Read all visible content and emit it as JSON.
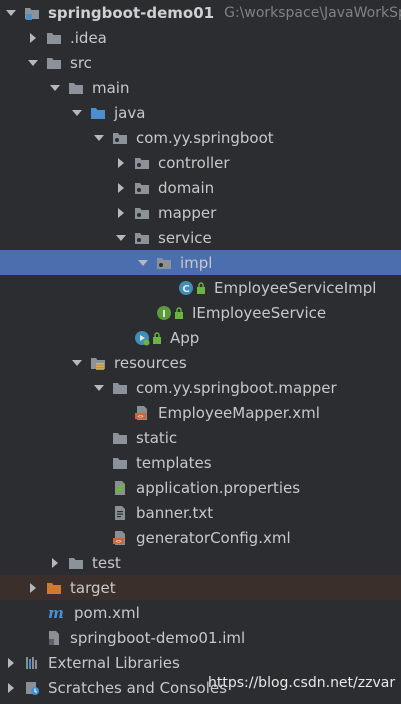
{
  "project_tree": {
    "items": [
      {
        "label": "springboot-demo01",
        "path": "G:\\workspace\\JavaWorkSp",
        "depth": 0,
        "arrow": "down",
        "icons": [
          "module-folder-icon"
        ],
        "bold": true
      },
      {
        "label": ".idea",
        "depth": 1,
        "arrow": "right",
        "icons": [
          "folder-icon"
        ]
      },
      {
        "label": "src",
        "depth": 1,
        "arrow": "down",
        "icons": [
          "folder-icon"
        ]
      },
      {
        "label": "main",
        "depth": 2,
        "arrow": "down",
        "icons": [
          "folder-icon"
        ]
      },
      {
        "label": "java",
        "depth": 3,
        "arrow": "down",
        "icons": [
          "source-folder-icon"
        ]
      },
      {
        "label": "com.yy.springboot",
        "depth": 4,
        "arrow": "down",
        "icons": [
          "package-icon"
        ]
      },
      {
        "label": "controller",
        "depth": 5,
        "arrow": "right",
        "icons": [
          "package-icon"
        ]
      },
      {
        "label": "domain",
        "depth": 5,
        "arrow": "right",
        "icons": [
          "package-icon"
        ]
      },
      {
        "label": "mapper",
        "depth": 5,
        "arrow": "right",
        "icons": [
          "package-icon"
        ]
      },
      {
        "label": "service",
        "depth": 5,
        "arrow": "down",
        "icons": [
          "package-icon"
        ]
      },
      {
        "label": "impl",
        "depth": 6,
        "arrow": "down",
        "icons": [
          "package-icon"
        ],
        "selected": true
      },
      {
        "label": "EmployeeServiceImpl",
        "depth": 7,
        "arrow": "none",
        "icons": [
          "class-icon",
          "lock-icon"
        ]
      },
      {
        "label": "IEmployeeService",
        "depth": 6,
        "arrow": "none",
        "icons": [
          "interface-icon",
          "lock-icon"
        ]
      },
      {
        "label": "App",
        "depth": 5,
        "arrow": "none",
        "icons": [
          "spring-boot-app-icon",
          "lock-icon"
        ]
      },
      {
        "label": "resources",
        "depth": 3,
        "arrow": "down",
        "icons": [
          "resources-folder-icon"
        ]
      },
      {
        "label": "com.yy.springboot.mapper",
        "depth": 4,
        "arrow": "down",
        "icons": [
          "folder-icon"
        ]
      },
      {
        "label": "EmployeeMapper.xml",
        "depth": 5,
        "arrow": "none",
        "icons": [
          "xml-file-icon"
        ]
      },
      {
        "label": "static",
        "depth": 4,
        "arrow": "none",
        "icons": [
          "folder-icon"
        ]
      },
      {
        "label": "templates",
        "depth": 4,
        "arrow": "none",
        "icons": [
          "folder-icon"
        ]
      },
      {
        "label": "application.properties",
        "depth": 4,
        "arrow": "none",
        "icons": [
          "spring-properties-icon"
        ]
      },
      {
        "label": "banner.txt",
        "depth": 4,
        "arrow": "none",
        "icons": [
          "text-file-icon"
        ]
      },
      {
        "label": "generatorConfig.xml",
        "depth": 4,
        "arrow": "none",
        "icons": [
          "xml-file-icon"
        ]
      },
      {
        "label": "test",
        "depth": 2,
        "arrow": "right",
        "icons": [
          "folder-icon"
        ]
      },
      {
        "label": "target",
        "depth": 1,
        "arrow": "right",
        "icons": [
          "excluded-folder-icon"
        ],
        "excluded": true
      },
      {
        "label": "pom.xml",
        "depth": 1,
        "arrow": "none",
        "icons": [
          "maven-icon"
        ]
      },
      {
        "label": "springboot-demo01.iml",
        "depth": 1,
        "arrow": "none",
        "icons": [
          "iml-file-icon"
        ]
      },
      {
        "label": "External Libraries",
        "depth": 0,
        "arrow": "right",
        "icons": [
          "libraries-icon"
        ]
      },
      {
        "label": "Scratches and Consoles",
        "depth": 0,
        "arrow": "right",
        "icons": [
          "scratches-icon"
        ]
      }
    ]
  },
  "watermark": "https://blog.csdn.net/zzvar",
  "colors": {
    "background": "#2b2d30",
    "selection": "#4b6eaf",
    "text": "#c8c8c8",
    "path_text": "#7f8287",
    "folder": "#8c9299",
    "source_folder": "#4a8fcf",
    "excluded_folder": "#d07a2f",
    "class_icon": "#3f8fb4",
    "interface_icon": "#5a9b3a",
    "xml_icon": "#d0643a",
    "spring": "#6db33f"
  }
}
